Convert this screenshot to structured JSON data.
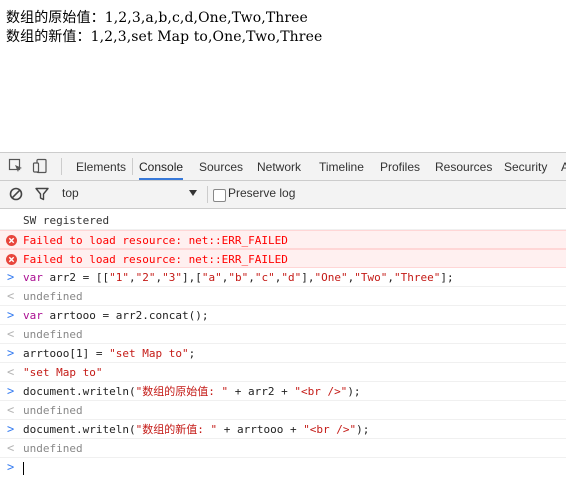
{
  "page": {
    "line1": "数组的原始值：1,2,3,a,b,c,d,One,Two,Three",
    "line2": "数组的新值：1,2,3,set Map to,One,Two,Three"
  },
  "devtools": {
    "tabs": [
      "Elements",
      "Console",
      "Sources",
      "Network",
      "Timeline",
      "Profiles",
      "Resources",
      "Security",
      "A"
    ],
    "active_tab": "Console",
    "icons": [
      "inspect-element-icon",
      "device-mode-icon"
    ],
    "filter": {
      "context": "top",
      "preserve_log_label": "Preserve log",
      "icons": [
        "clear-console-icon",
        "filter-icon"
      ]
    },
    "accent_color": "#3879d9",
    "error_color": "#ff0000"
  },
  "console": {
    "messages": [
      {
        "type": "log",
        "text": "SW registered"
      },
      {
        "type": "error",
        "text": "Failed to load resource: net::ERR_FAILED"
      },
      {
        "type": "error",
        "text": "Failed to load resource: net::ERR_FAILED"
      }
    ],
    "entries": [
      {
        "input_parts": [
          {
            "kind": "kw",
            "text": "var"
          },
          {
            "kind": "plain",
            "text": " arr2 = [["
          },
          {
            "kind": "str",
            "text": "\"1\""
          },
          {
            "kind": "plain",
            "text": ","
          },
          {
            "kind": "str",
            "text": "\"2\""
          },
          {
            "kind": "plain",
            "text": ","
          },
          {
            "kind": "str",
            "text": "\"3\""
          },
          {
            "kind": "plain",
            "text": "],["
          },
          {
            "kind": "str",
            "text": "\"a\""
          },
          {
            "kind": "plain",
            "text": ","
          },
          {
            "kind": "str",
            "text": "\"b\""
          },
          {
            "kind": "plain",
            "text": ","
          },
          {
            "kind": "str",
            "text": "\"c\""
          },
          {
            "kind": "plain",
            "text": ","
          },
          {
            "kind": "str",
            "text": "\"d\""
          },
          {
            "kind": "plain",
            "text": "],"
          },
          {
            "kind": "str",
            "text": "\"One\""
          },
          {
            "kind": "plain",
            "text": ","
          },
          {
            "kind": "str",
            "text": "\"Two\""
          },
          {
            "kind": "plain",
            "text": ","
          },
          {
            "kind": "str",
            "text": "\"Three\""
          },
          {
            "kind": "plain",
            "text": "];"
          }
        ],
        "result": "undefined",
        "result_kind": "result"
      },
      {
        "input_parts": [
          {
            "kind": "kw",
            "text": "var"
          },
          {
            "kind": "plain",
            "text": " arrtooo = arr2.concat();"
          }
        ],
        "result": "undefined",
        "result_kind": "result"
      },
      {
        "input_parts": [
          {
            "kind": "plain",
            "text": "arrtooo[1] = "
          },
          {
            "kind": "str",
            "text": "\"set Map to\""
          },
          {
            "kind": "plain",
            "text": ";"
          }
        ],
        "result": "\"set Map to\"",
        "result_kind": "result-str"
      },
      {
        "input_parts": [
          {
            "kind": "plain",
            "text": "document.writeln("
          },
          {
            "kind": "str",
            "text": "\"数组的原始值: \""
          },
          {
            "kind": "plain",
            "text": " + arr2 + "
          },
          {
            "kind": "str",
            "text": "\"<br />\""
          },
          {
            "kind": "plain",
            "text": ");"
          }
        ],
        "result": "undefined",
        "result_kind": "result"
      },
      {
        "input_parts": [
          {
            "kind": "plain",
            "text": "document.writeln("
          },
          {
            "kind": "str",
            "text": "\"数组的新值: \""
          },
          {
            "kind": "plain",
            "text": " + arrtooo + "
          },
          {
            "kind": "str",
            "text": "\"<br />\""
          },
          {
            "kind": "plain",
            "text": ");"
          }
        ],
        "result": "undefined",
        "result_kind": "result"
      }
    ],
    "prompt_symbol": ">",
    "result_symbol": "<"
  }
}
